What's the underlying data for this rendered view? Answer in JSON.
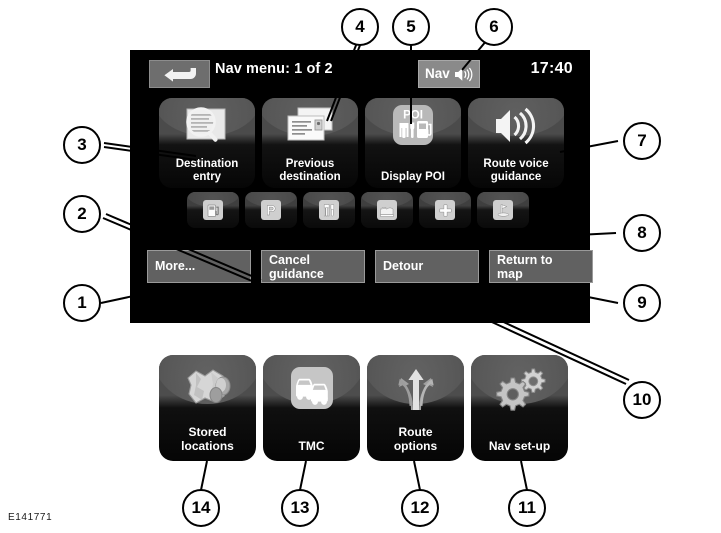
{
  "figure": {
    "code": "E141771"
  },
  "screen": {
    "statusbar": {
      "back_button": "back-arrow-icon",
      "title": "Nav menu: 1 of 2",
      "nav_badge_label": "Nav",
      "nav_badge_icon": "speaker-icon",
      "clock": "17:40"
    },
    "tiles": [
      {
        "label": "Destination\nentry",
        "line1": "Destination",
        "line2": "entry",
        "icon": "magnifier-over-map-icon"
      },
      {
        "label": "Previous\ndestination",
        "line1": "Previous",
        "line2": "destination",
        "icon": "envelopes-icon"
      },
      {
        "label": "Display POI",
        "line1": "Display POI",
        "line2": "",
        "icon": "poi-icon",
        "icon_text": "POI"
      },
      {
        "label": "Route voice\nguidance",
        "line1": "Route voice",
        "line2": "guidance",
        "icon": "loudspeaker-icon"
      }
    ],
    "poi_shortcuts": [
      {
        "icon": "fuel-pump-icon"
      },
      {
        "icon": "parking-p-icon",
        "glyph": "P"
      },
      {
        "icon": "restaurant-cutlery-icon"
      },
      {
        "icon": "hotel-bed-icon"
      },
      {
        "icon": "hospital-plus-icon",
        "glyph": "+"
      },
      {
        "icon": "golf-flag-icon"
      }
    ],
    "bottom_buttons": [
      {
        "name": "more",
        "line1": "More...",
        "line2": ""
      },
      {
        "name": "cancel-guidance",
        "line1": "Cancel",
        "line2": "guidance"
      },
      {
        "name": "detour",
        "line1": "Detour",
        "line2": ""
      },
      {
        "name": "return-to-map",
        "line1": "Return to",
        "line2": "map"
      }
    ]
  },
  "lower_tiles": [
    {
      "line1": "Stored",
      "line2": "locations",
      "icon": "map-pins-icon"
    },
    {
      "line1": "TMC",
      "line2": "",
      "icon": "traffic-cars-icon"
    },
    {
      "line1": "Route",
      "line2": "options",
      "icon": "route-arrows-icon"
    },
    {
      "line1": "Nav set-up",
      "line2": "",
      "icon": "gears-icon"
    }
  ],
  "callouts": [
    {
      "n": "1"
    },
    {
      "n": "2"
    },
    {
      "n": "3"
    },
    {
      "n": "4"
    },
    {
      "n": "5"
    },
    {
      "n": "6"
    },
    {
      "n": "7"
    },
    {
      "n": "8"
    },
    {
      "n": "9"
    },
    {
      "n": "10"
    },
    {
      "n": "11"
    },
    {
      "n": "12"
    },
    {
      "n": "13"
    },
    {
      "n": "14"
    }
  ]
}
